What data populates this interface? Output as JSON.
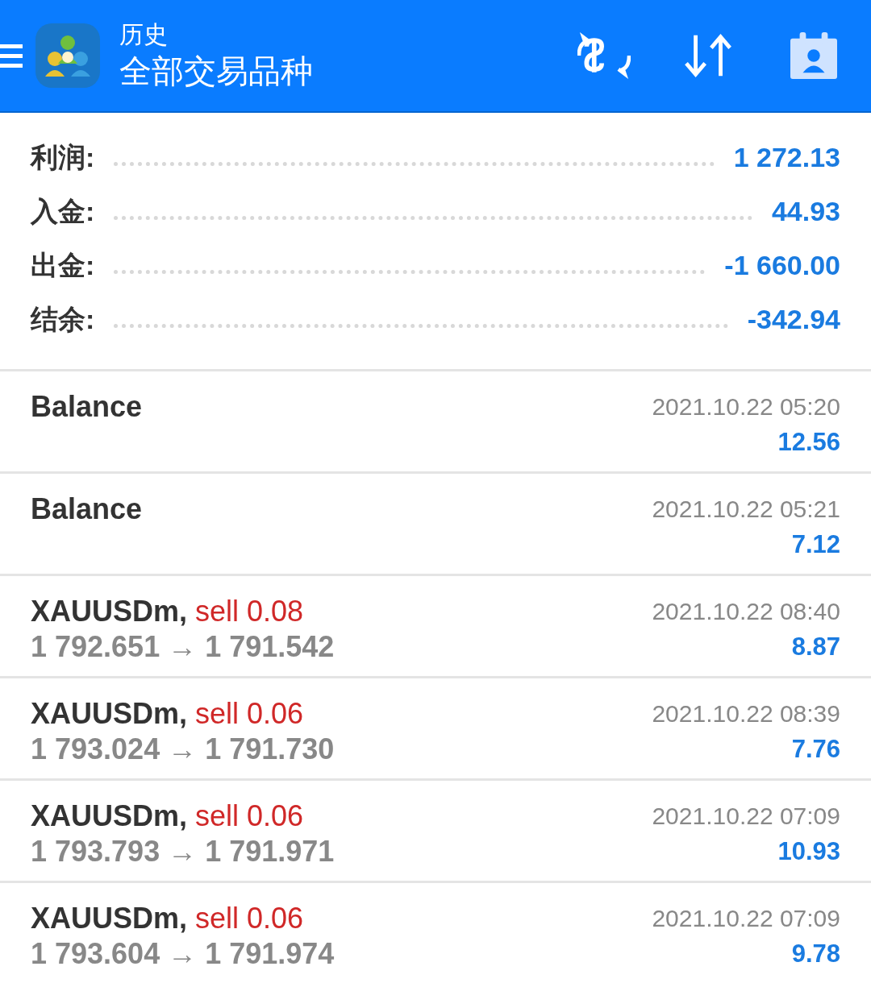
{
  "header": {
    "subtitle": "历史",
    "title": "全部交易品种"
  },
  "summary": [
    {
      "label": "利润:",
      "value": "1 272.13"
    },
    {
      "label": "入金:",
      "value": "44.93"
    },
    {
      "label": "出金:",
      "value": "-1 660.00"
    },
    {
      "label": "结余:",
      "value": "-342.94"
    }
  ],
  "deals": [
    {
      "kind": "balance",
      "title": "Balance",
      "time": "2021.10.22 05:20",
      "profit": "12.56"
    },
    {
      "kind": "balance",
      "title": "Balance",
      "time": "2021.10.22 05:21",
      "profit": "7.12"
    },
    {
      "kind": "trade",
      "title": "XAUUSDm,",
      "side": "sell 0.08",
      "prices": "1 792.651 → 1 791.542",
      "time": "2021.10.22 08:40",
      "profit": "8.87"
    },
    {
      "kind": "trade",
      "title": "XAUUSDm,",
      "side": "sell 0.06",
      "prices": "1 793.024 → 1 791.730",
      "time": "2021.10.22 08:39",
      "profit": "7.76"
    },
    {
      "kind": "trade",
      "title": "XAUUSDm,",
      "side": "sell 0.06",
      "prices": "1 793.793 → 1 791.971",
      "time": "2021.10.22 07:09",
      "profit": "10.93"
    },
    {
      "kind": "trade",
      "title": "XAUUSDm,",
      "side": "sell 0.06",
      "prices": "1 793.604 → 1 791.974",
      "time": "2021.10.22 07:09",
      "profit": "9.78"
    }
  ]
}
